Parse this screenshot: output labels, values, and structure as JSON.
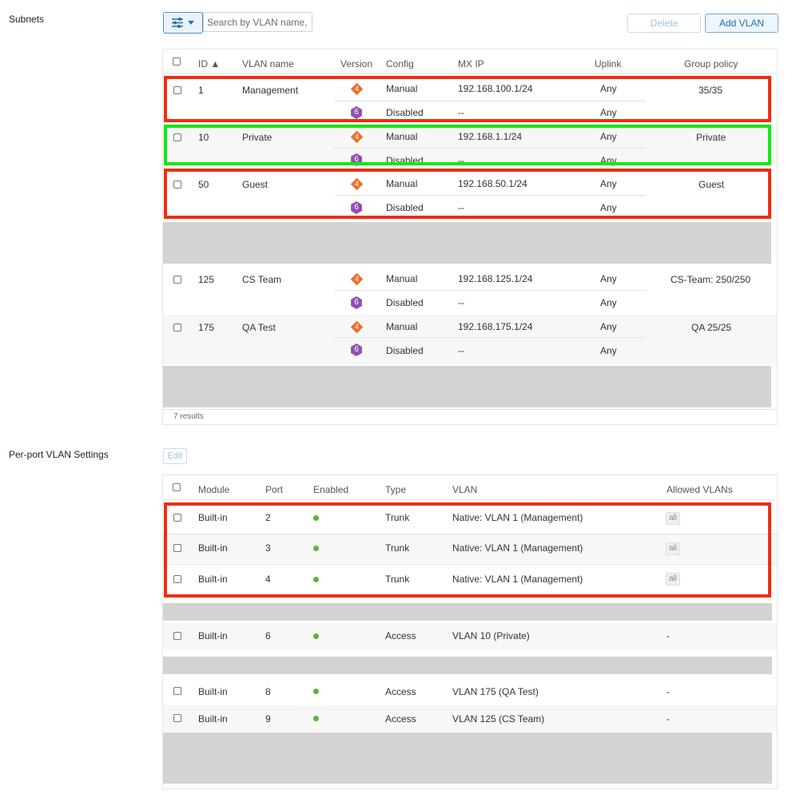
{
  "subnets": {
    "section_label": "Subnets",
    "search_placeholder": "Search by VLAN name, ",
    "delete_label": "Delete",
    "add_label": "Add VLAN",
    "headers": {
      "id": "ID ▲",
      "name": "VLAN name",
      "version": "Version",
      "config": "Config",
      "mxip": "MX IP",
      "uplink": "Uplink",
      "policy": "Group policy"
    },
    "vlans": [
      {
        "id": "1",
        "name": "Management",
        "v4": "4",
        "v6": "6",
        "cfg4": "Manual",
        "ip4": "192.168.100.1/24",
        "up4": "Any",
        "cfg6": "Disabled",
        "ip6": "--",
        "up6": "Any",
        "policy": "35/35"
      },
      {
        "id": "10",
        "name": "Private",
        "v4": "4",
        "v6": "6",
        "cfg4": "Manual",
        "ip4": "192.168.1.1/24",
        "up4": "Any",
        "cfg6": "Disabled",
        "ip6": "--",
        "up6": "Any",
        "policy": "Private"
      },
      {
        "id": "50",
        "name": "Guest",
        "v4": "4",
        "v6": "6",
        "cfg4": "Manual",
        "ip4": "192.168.50.1/24",
        "up4": "Any",
        "cfg6": "Disabled",
        "ip6": "--",
        "up6": "Any",
        "policy": "Guest"
      },
      {
        "id": "125",
        "name": "CS Team",
        "v4": "4",
        "v6": "6",
        "cfg4": "Manual",
        "ip4": "192.168.125.1/24",
        "up4": "Any",
        "cfg6": "Disabled",
        "ip6": "--",
        "up6": "Any",
        "policy": "CS-Team: 250/250"
      },
      {
        "id": "175",
        "name": "QA Test",
        "v4": "4",
        "v6": "6",
        "cfg4": "Manual",
        "ip4": "192.168.175.1/24",
        "up4": "Any",
        "cfg6": "Disabled",
        "ip6": "--",
        "up6": "Any",
        "policy": "QA 25/25"
      }
    ],
    "results": "7 results"
  },
  "perport": {
    "section_label": "Per-port VLAN Settings",
    "edit_label": "Edit",
    "headers": {
      "module": "Module",
      "port": "Port",
      "enabled": "Enabled",
      "type": "Type",
      "vlan": "VLAN",
      "allowed": "Allowed VLANs"
    },
    "ports": [
      {
        "module": "Built-in",
        "port": "2",
        "type": "Trunk",
        "vlan": "Native: VLAN 1 (Management)",
        "allowed": "all"
      },
      {
        "module": "Built-in",
        "port": "3",
        "type": "Trunk",
        "vlan": "Native: VLAN 1 (Management)",
        "allowed": "all"
      },
      {
        "module": "Built-in",
        "port": "4",
        "type": "Trunk",
        "vlan": "Native: VLAN 1 (Management)",
        "allowed": "all"
      },
      {
        "module": "Built-in",
        "port": "6",
        "type": "Access",
        "vlan": "VLAN 10 (Private)",
        "allowed": "-"
      },
      {
        "module": "Built-in",
        "port": "8",
        "type": "Access",
        "vlan": "VLAN 175 (QA Test)",
        "allowed": "-"
      },
      {
        "module": "Built-in",
        "port": "9",
        "type": "Access",
        "vlan": "VLAN 125 (CS Team)",
        "allowed": "-"
      }
    ]
  },
  "colors": {
    "highlight_red": "#f02d13",
    "highlight_green": "#12e812",
    "ipv4_badge": "#e3732f",
    "ipv6_badge": "#8f4fb0",
    "enabled_dot": "#5bb33f"
  }
}
